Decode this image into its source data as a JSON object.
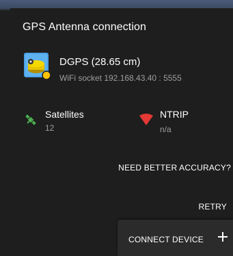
{
  "dialog": {
    "title": "GPS Antenna connection"
  },
  "device": {
    "name": "DGPS (28.65 cm)",
    "connection": "WiFi socket 192.168.43.40 : 5555",
    "icon": "gps-receiver-icon",
    "status_color": "#ffc107",
    "body_color": "#f5d000",
    "tile_color": "#4da3e8"
  },
  "satellites": {
    "label": "Satellites",
    "value": "12",
    "icon": "satellite-icon",
    "icon_color": "#4caf50"
  },
  "ntrip": {
    "label": "NTRIP",
    "value": "n/a",
    "icon": "signal-icon",
    "icon_color": "#e53935"
  },
  "actions": {
    "accuracy_label": "NEED BETTER ACCURACY?",
    "retry_label": "RETRY",
    "connect_label": "CONNECT DEVICE"
  }
}
